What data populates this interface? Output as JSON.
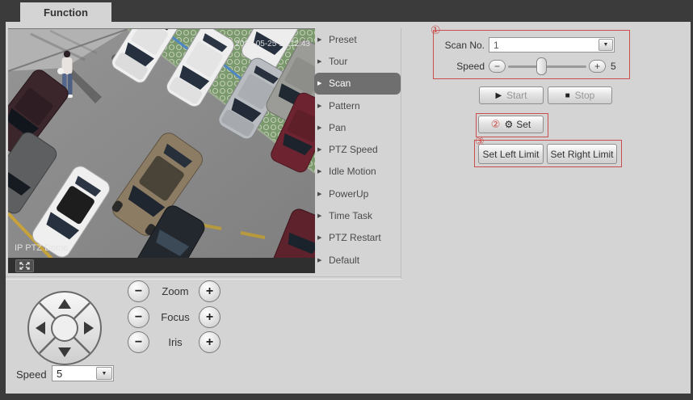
{
  "window": {
    "tab": "Function"
  },
  "video": {
    "timestamp": "2017-05-25 15:12:43",
    "osd_label": "IP PTZ Dome"
  },
  "menu": {
    "items": [
      {
        "label": "Preset"
      },
      {
        "label": "Tour"
      },
      {
        "label": "Scan"
      },
      {
        "label": "Pattern"
      },
      {
        "label": "Pan"
      },
      {
        "label": "PTZ Speed"
      },
      {
        "label": "Idle Motion"
      },
      {
        "label": "PowerUp"
      },
      {
        "label": "Time Task"
      },
      {
        "label": "PTZ Restart"
      },
      {
        "label": "Default"
      }
    ],
    "arrow_icon": "▶"
  },
  "scan_panel": {
    "annotation_1": "①",
    "annotation_2": "②",
    "annotation_3": "③",
    "scan_no_label": "Scan No.",
    "scan_no_value": "1",
    "speed_label": "Speed",
    "speed_value": "5",
    "minus_glyph": "−",
    "plus_glyph": "+",
    "start_label": "Start",
    "stop_label": "Stop",
    "set_label": "Set",
    "set_left_label": "Set Left Limit",
    "set_right_label": "Set Right Limit",
    "start_icon": "▶",
    "stop_icon": "■",
    "set_icon": "⚙",
    "dropdown_icon": "▼"
  },
  "ptz": {
    "zoom_label": "Zoom",
    "focus_label": "Focus",
    "iris_label": "Iris",
    "minus_glyph": "−",
    "plus_glyph": "+",
    "speed_label": "Speed",
    "speed_value": "5",
    "dropdown_icon": "▼"
  },
  "colors": {
    "annotation_red": "#c94f4f",
    "menu_highlight": "#6f6f6f",
    "frame_dark": "#3b3b3b"
  }
}
